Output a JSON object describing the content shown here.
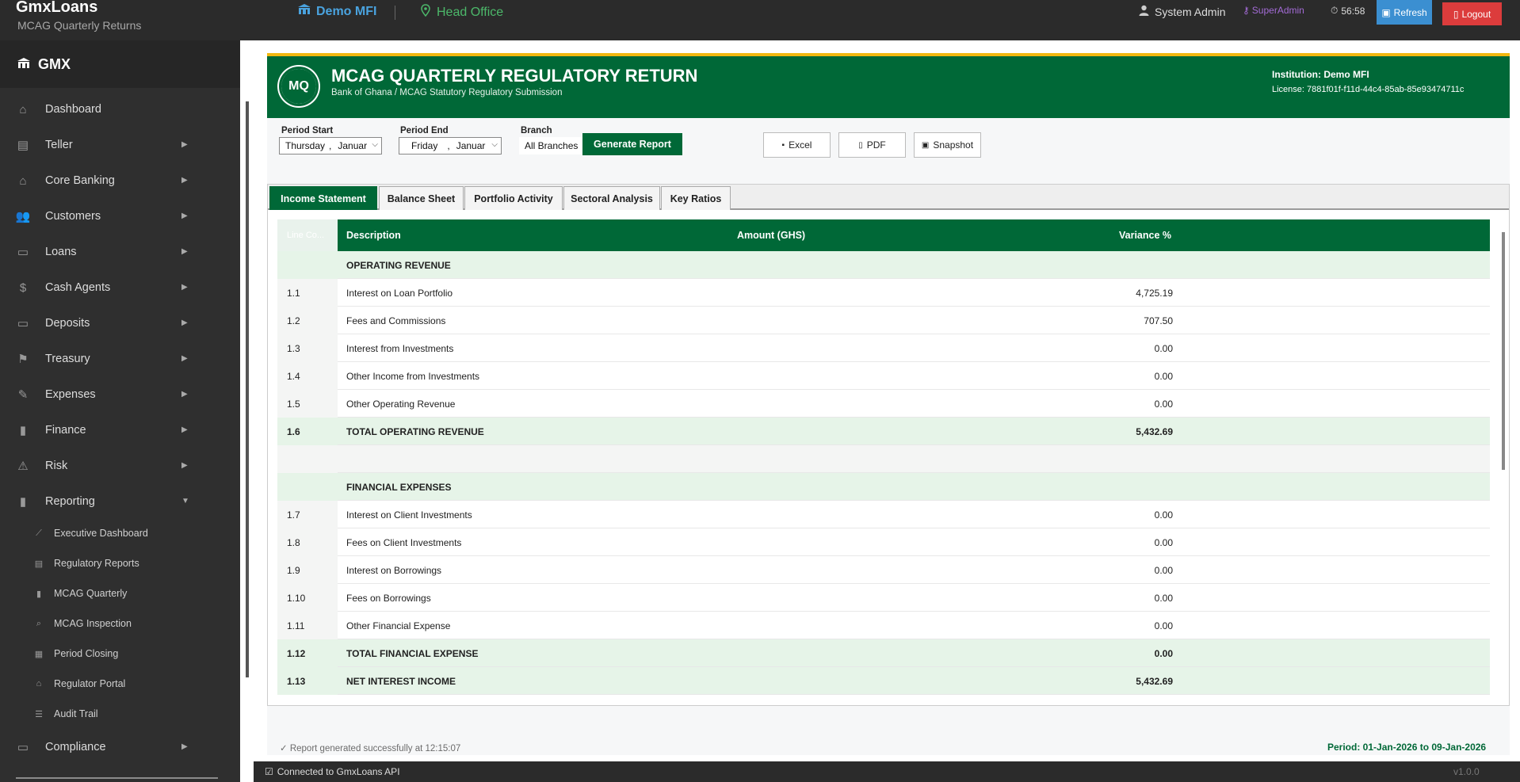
{
  "topbar": {
    "app_title": "GmxLoans",
    "app_subtitle": "MCAG Quarterly Returns",
    "company": "Demo MFI",
    "branch": "Head Office",
    "user": "System Admin",
    "role": "SuperAdmin",
    "timer": "56:58",
    "refresh_label": "Refresh",
    "logout_label": "Logout"
  },
  "sidebar": {
    "brand": "GMX",
    "items": [
      {
        "label": "Dashboard",
        "icon": "dashboard-icon",
        "has_arrow": false
      },
      {
        "label": "Teller",
        "icon": "teller-icon",
        "has_arrow": true
      },
      {
        "label": "Core Banking",
        "icon": "bank-icon",
        "has_arrow": true
      },
      {
        "label": "Customers",
        "icon": "customers-icon",
        "has_arrow": true
      },
      {
        "label": "Loans",
        "icon": "loans-icon",
        "has_arrow": true
      },
      {
        "label": "Cash Agents",
        "icon": "cash-bag-icon",
        "has_arrow": true
      },
      {
        "label": "Deposits",
        "icon": "atm-icon",
        "has_arrow": true
      },
      {
        "label": "Treasury",
        "icon": "treasury-icon",
        "has_arrow": true
      },
      {
        "label": "Expenses",
        "icon": "expenses-icon",
        "has_arrow": true
      },
      {
        "label": "Finance",
        "icon": "finance-chart-icon",
        "has_arrow": true
      },
      {
        "label": "Risk",
        "icon": "warning-icon",
        "has_arrow": true
      },
      {
        "label": "Reporting",
        "icon": "reporting-icon",
        "has_arrow": true
      }
    ],
    "reporting_sub": [
      {
        "label": "Executive Dashboard",
        "icon": "chart-line-icon"
      },
      {
        "label": "Regulatory Reports",
        "icon": "document-icon"
      },
      {
        "label": "MCAG Quarterly",
        "icon": "bar-chart-icon"
      },
      {
        "label": "MCAG Inspection",
        "icon": "magnifier-icon"
      },
      {
        "label": "Period Closing",
        "icon": "calendar-icon"
      },
      {
        "label": "Regulator Portal",
        "icon": "institution-icon"
      },
      {
        "label": "Audit Trail",
        "icon": "list-icon"
      }
    ],
    "compliance": {
      "label": "Compliance",
      "icon": "compliance-icon"
    }
  },
  "report": {
    "logo_text": "MQ",
    "title": "MCAG QUARTERLY REGULATORY RETURN",
    "subtitle": "Bank of Ghana / MCAG Statutory Regulatory Submission",
    "institution": "Institution: Demo MFI",
    "license": "License: 7881f01f-f11d-44c4-85ab-85e93474711c"
  },
  "filters": {
    "period_start_label": "Period Start",
    "period_start_day": "Thursday",
    "period_start_month": "Januar",
    "period_end_label": "Period End",
    "period_end_day": "Friday",
    "period_end_month": "Januar",
    "branch_label": "Branch",
    "branch_value": "All Branches",
    "generate_label": "Generate Report",
    "excel_label": "Excel",
    "pdf_label": "PDF",
    "snapshot_label": "Snapshot"
  },
  "tabs": [
    "Income Statement",
    "Balance Sheet",
    "Portfolio Activity",
    "Sectoral Analysis",
    "Key Ratios"
  ],
  "table": {
    "headers": {
      "line": "Line Co...",
      "description": "Description",
      "amount": "Amount (GHS)",
      "variance": "Variance %"
    },
    "rows": [
      {
        "type": "section",
        "line": "",
        "desc": "OPERATING REVENUE",
        "amount": ""
      },
      {
        "type": "normal",
        "line": "1.1",
        "desc": "Interest on Loan Portfolio",
        "amount": "4,725.19"
      },
      {
        "type": "normal",
        "line": "1.2",
        "desc": "Fees and Commissions",
        "amount": "707.50"
      },
      {
        "type": "normal",
        "line": "1.3",
        "desc": "Interest from Investments",
        "amount": "0.00"
      },
      {
        "type": "normal",
        "line": "1.4",
        "desc": "Other Income from Investments",
        "amount": "0.00"
      },
      {
        "type": "normal",
        "line": "1.5",
        "desc": "Other Operating Revenue",
        "amount": "0.00"
      },
      {
        "type": "total",
        "line": "1.6",
        "desc": "TOTAL OPERATING REVENUE",
        "amount": "5,432.69"
      },
      {
        "type": "spacer",
        "line": "",
        "desc": "",
        "amount": ""
      },
      {
        "type": "section",
        "line": "",
        "desc": "FINANCIAL EXPENSES",
        "amount": ""
      },
      {
        "type": "normal",
        "line": "1.7",
        "desc": "Interest on Client Investments",
        "amount": "0.00"
      },
      {
        "type": "normal",
        "line": "1.8",
        "desc": "Fees on Client Investments",
        "amount": "0.00"
      },
      {
        "type": "normal",
        "line": "1.9",
        "desc": "Interest on Borrowings",
        "amount": "0.00"
      },
      {
        "type": "normal",
        "line": "1.10",
        "desc": "Fees on Borrowings",
        "amount": "0.00"
      },
      {
        "type": "normal",
        "line": "1.11",
        "desc": "Other Financial Expense",
        "amount": "0.00"
      },
      {
        "type": "total",
        "line": "1.12",
        "desc": "TOTAL FINANCIAL EXPENSE",
        "amount": "0.00"
      },
      {
        "type": "total",
        "line": "1.13",
        "desc": "NET INTEREST INCOME",
        "amount": "5,432.69"
      }
    ]
  },
  "status": {
    "message": "✓ Report generated successfully at 12:15:07",
    "period": "Period: 01-Jan-2026 to 09-Jan-2026"
  },
  "footer": {
    "connection": "Connected to GmxLoans API",
    "version": "v1.0.0"
  },
  "colors": {
    "brand_green": "#006837",
    "accent_yellow": "#f2b810",
    "refresh_blue": "#3b8fd1",
    "logout_red": "#dc3c3c"
  }
}
